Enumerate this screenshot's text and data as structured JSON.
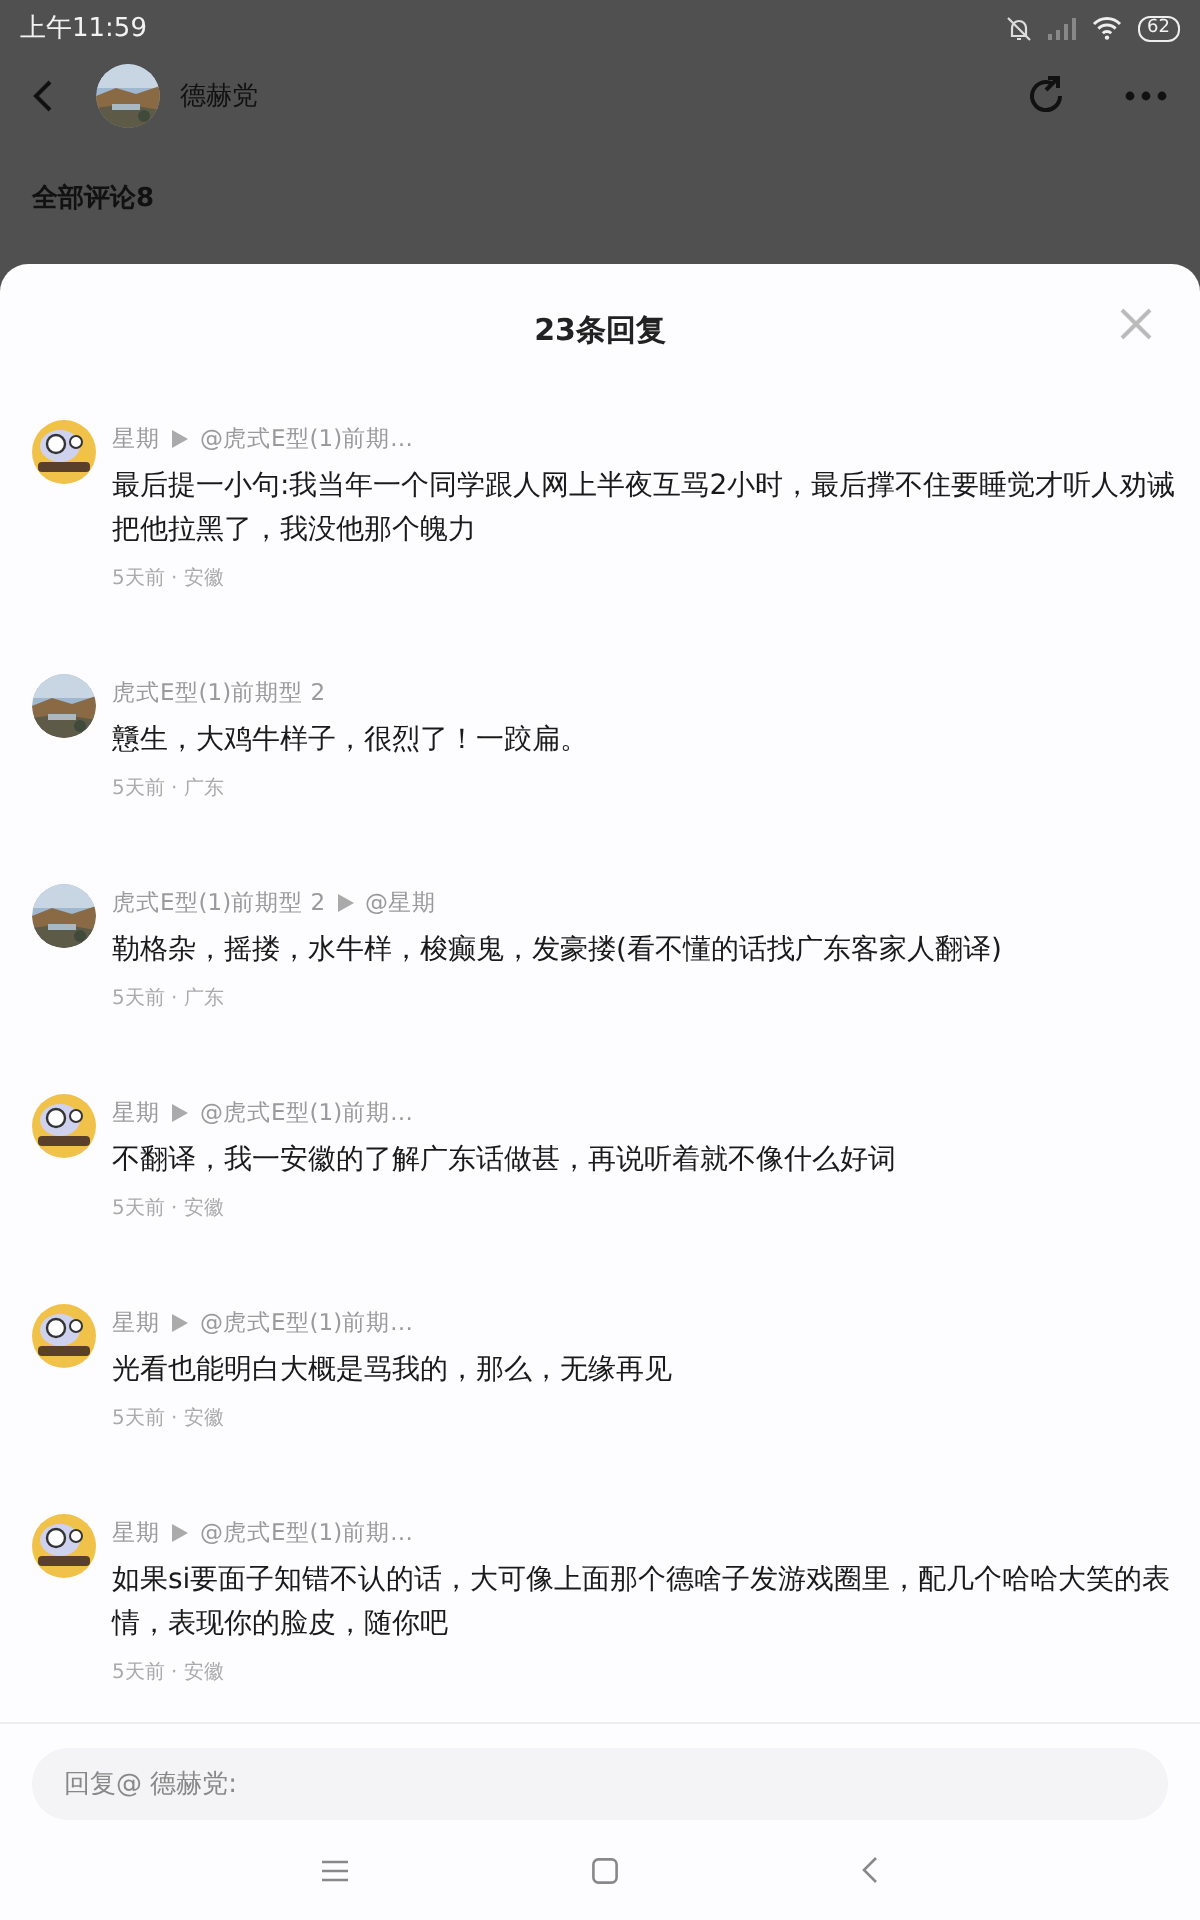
{
  "status_bar": {
    "time": "上午11:59",
    "battery": "62"
  },
  "header": {
    "title": "德赫党"
  },
  "comments_heading": "全部评论8",
  "reply_sheet": {
    "title": "23条回复",
    "replies": [
      {
        "kind": "cartoon",
        "author": "星期",
        "reply_to": "@虎式E型(1)前期…",
        "text": "最后提一小句:我当年一个同学跟人网上半夜互骂2小时，最后撑不住要睡觉才听人劝诫把他拉黑了，我没他那个魄力",
        "meta": "5天前 · 安徽"
      },
      {
        "author": "虎式E型(1)前期型 2",
        "text": "戇生，大鸡牛样子，很烈了！一跤扁。",
        "meta": "5天前 · 广东"
      },
      {
        "author": "虎式E型(1)前期型 2",
        "reply_to": "@星期",
        "text": "勒格杂，摇搂，水牛样，梭癫鬼，发豪搂(看不懂的话找广东客家人翻译)",
        "meta": "5天前 · 广东"
      },
      {
        "kind": "cartoon",
        "author": "星期",
        "reply_to": "@虎式E型(1)前期…",
        "text": "不翻译，我一安徽的了解广东话做甚，再说听着就不像什么好词",
        "meta": "5天前 · 安徽"
      },
      {
        "kind": "cartoon",
        "author": "星期",
        "reply_to": "@虎式E型(1)前期…",
        "text": "光看也能明白大概是骂我的，那么，无缘再见",
        "meta": "5天前 · 安徽"
      },
      {
        "kind": "cartoon",
        "author": "星期",
        "reply_to": "@虎式E型(1)前期…",
        "text": "如果si要面子知错不认的话，大可像上面那个德啥子发游戏圈里，配几个哈哈大笑的表情，表现你的脸皮，随你吧",
        "meta": "5天前 · 安徽"
      }
    ]
  },
  "reply_input": {
    "placeholder": "回复@ 德赫党:"
  }
}
